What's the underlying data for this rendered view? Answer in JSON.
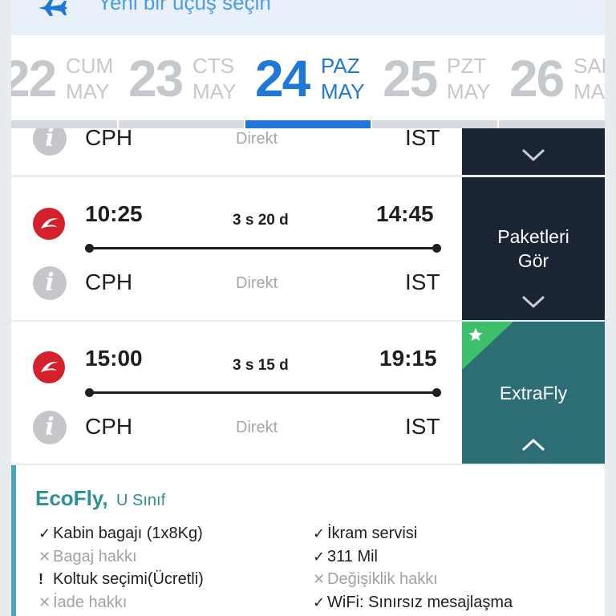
{
  "header": {
    "title": "Yeni bir uçuş seçin",
    "icon": "airplane-icon",
    "color": "#4d9de6"
  },
  "dates": [
    {
      "day": "22",
      "weekday": "CUM",
      "month": "MAY",
      "active": false
    },
    {
      "day": "23",
      "weekday": "CTS",
      "month": "MAY",
      "active": false
    },
    {
      "day": "24",
      "weekday": "PAZ",
      "month": "MAY",
      "active": true
    },
    {
      "day": "25",
      "weekday": "PZT",
      "month": "MAY",
      "active": false
    },
    {
      "day": "26",
      "weekday": "SAL",
      "month": "MAY",
      "active": false
    }
  ],
  "flights": [
    {
      "dep_code": "CPH",
      "direct": "Direkt",
      "arr_code": "IST",
      "action": "",
      "action_icon": "chevron-down-icon"
    },
    {
      "dep_time": "10:25",
      "duration": "3 s 20 d",
      "arr_time": "14:45",
      "dep_code": "CPH",
      "direct": "Direkt",
      "arr_code": "IST",
      "action": "Paketleri Gör",
      "action_icon": "chevron-down-icon"
    },
    {
      "dep_time": "15:00",
      "duration": "3 s 15 d",
      "arr_time": "19:15",
      "dep_code": "CPH",
      "direct": "Direkt",
      "arr_code": "IST",
      "action": "ExtraFly",
      "action_icon": "chevron-up-icon",
      "badge": "star-icon"
    }
  ],
  "fare": {
    "name": "EcoFly,",
    "class": "U Sınıf",
    "features_left": [
      {
        "mark": "✓",
        "text": "Kabin bagajı (1x8Kg)",
        "status": "ok"
      },
      {
        "mark": "✕",
        "text": "Bagaj hakkı",
        "status": "no"
      },
      {
        "mark": "!",
        "text": "Koltuk seçimi(Ücretli)",
        "status": "warn"
      },
      {
        "mark": "✕",
        "text": "İade hakkı",
        "status": "no"
      }
    ],
    "features_right": [
      {
        "mark": "✓",
        "text": "İkram servisi",
        "status": "ok"
      },
      {
        "mark": "✓",
        "text": "311 Mil",
        "status": "ok"
      },
      {
        "mark": "✕",
        "text": "Değişiklik hakkı",
        "status": "no"
      },
      {
        "mark": "✓",
        "text": "WiFi: Sınırsız mesajlaşma",
        "status": "ok"
      }
    ]
  },
  "colors": {
    "accent_blue": "#1f77d8",
    "dark_panel": "#1a2433",
    "teal_panel": "#2d6e74",
    "green_badge": "#3cc06a",
    "brand_red": "#d4202b"
  }
}
